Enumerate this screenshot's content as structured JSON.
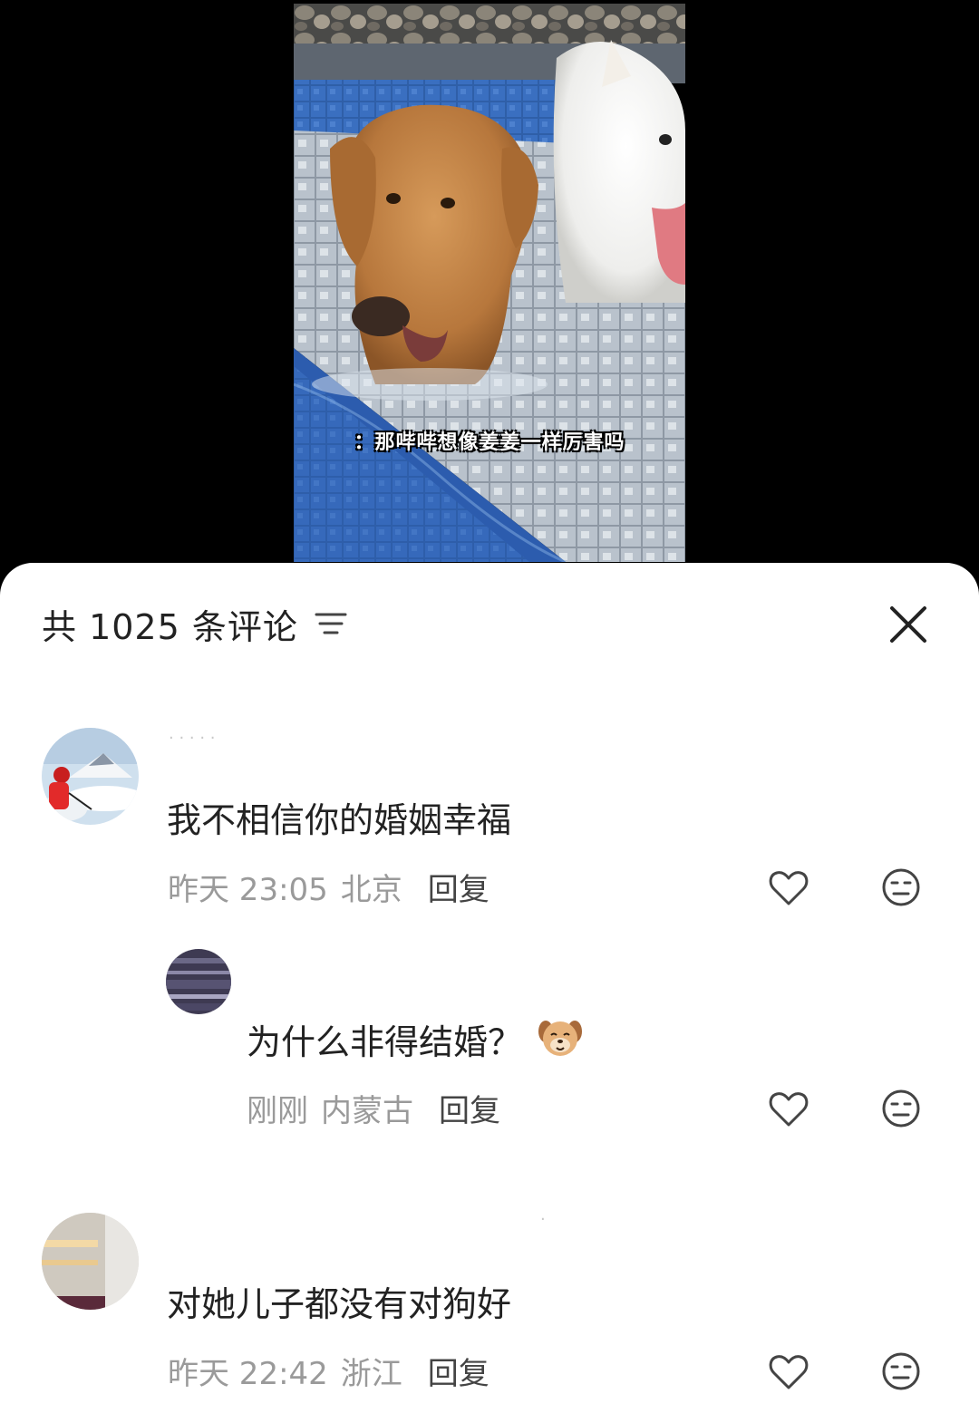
{
  "video": {
    "subtitle": "：那哔哔想像姜姜一样厉害吗"
  },
  "sheet": {
    "title": "共 1025 条评论",
    "sort_icon": "filter-lines-icon",
    "close_icon": "close-x-icon"
  },
  "comments": [
    {
      "username": "· · · · ·",
      "text": "我不相信你的婚姻幸福",
      "date": "昨天 23:05",
      "location": "北京",
      "reply_label": "回复",
      "like_icon": "heart-outline-icon",
      "dislike_icon": "meh-face-icon",
      "replies": [
        {
          "text": "为什么非得结婚？",
          "emoji": "dog-face-emoji",
          "date": "刚刚",
          "location": "内蒙古",
          "reply_label": "回复"
        }
      ]
    },
    {
      "username": "·",
      "text": "对她儿子都没有对狗好",
      "date": "昨天 22:42",
      "location": "浙江",
      "reply_label": "回复"
    }
  ]
}
